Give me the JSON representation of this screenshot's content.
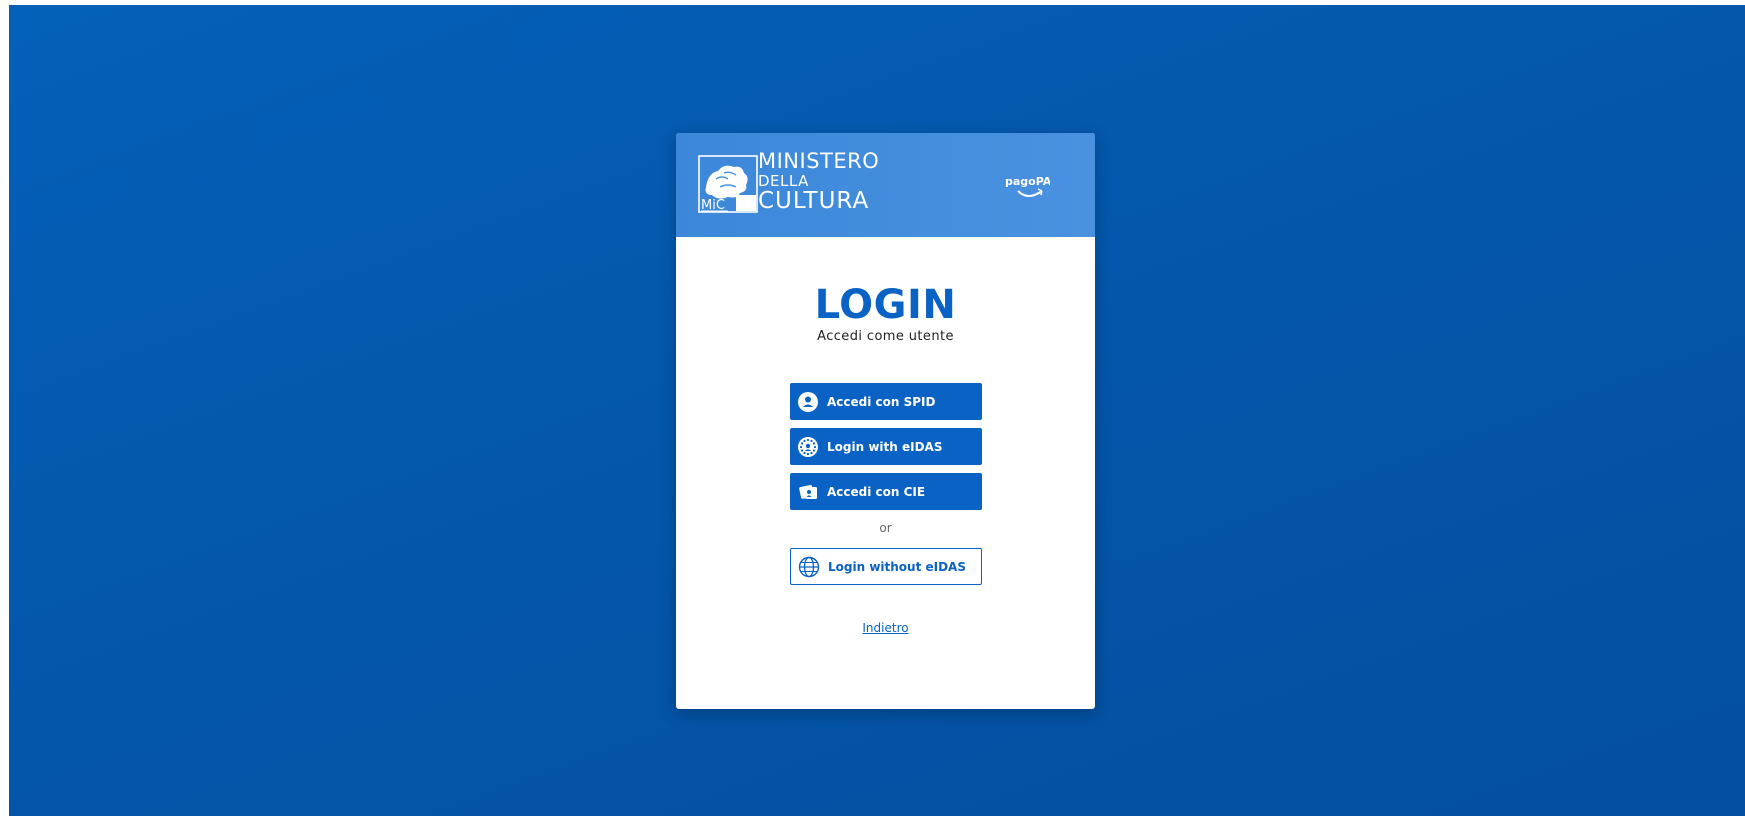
{
  "header": {
    "ministry_line1": "MINISTERO",
    "ministry_line2": "DELLA",
    "ministry_line3": "CULTURA",
    "mic_logo_text": "MiC",
    "pagopa_logo_text": "pagoPA"
  },
  "login": {
    "title": "LOGIN",
    "subtitle": "Accedi come utente"
  },
  "buttons": {
    "spid": {
      "label": "Accedi con SPID",
      "icon": "user-circle-icon"
    },
    "eidas": {
      "label": "Login with eIDAS",
      "icon": "eu-stars-icon"
    },
    "cie": {
      "label": "Accedi con CIE",
      "icon": "id-card-icon"
    },
    "or_text": "or",
    "no_eidas": {
      "label": "Login without eIDAS",
      "icon": "globe-icon"
    }
  },
  "footer": {
    "back_link": "Indietro"
  },
  "colors": {
    "background": "#0458aa",
    "header": "#4a90df",
    "primary": "#0a63c4",
    "card": "#ffffff"
  }
}
